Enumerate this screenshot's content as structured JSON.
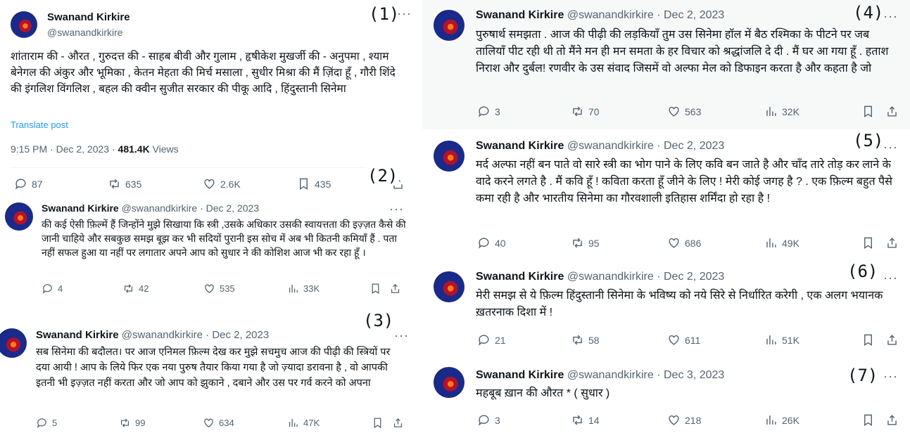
{
  "tweets": [
    {
      "n": "(1)",
      "name": "Swanand Kirkire",
      "handle": "@swanandkirkire",
      "text": "शांताराम की - औरत , गुरुदत्त की - साहब बीवी और गुलाम , हृषीकेश मुखर्जी की - अनुपमा , श्याम बेनेगल की अंकुर और भूमिका , केतन मेहता की मिर्च मसाला , सुधीर मिश्रा की मैं ज़िंदा हूँ , गौरी शिंदे की इंगलिश विंगलिश , बहल की क्वीन सुजीत सरकार की पीकू आदि , हिंदुस्तानी सिनेमा",
      "translate": "Translate post",
      "time": "9:15 PM · Dec 2, 2023 · ",
      "views": "481.4K",
      "views_label": " Views",
      "replies": "87",
      "reposts": "635",
      "likes": "2.6K",
      "bookmarks": "435"
    },
    {
      "n": "(2)",
      "name": "Swanand Kirkire",
      "meta": "@swanandkirkire · Dec 2, 2023",
      "text": "की कई ऐसी  फ़िल्में हैं  जिन्होंने मुझे सिखाया कि स्त्री ,उसके अधिकार उसकी स्वायत्तता की इज़्ज़त कैसे की जानी चाहिये और सबकुछ समझ बूझ कर भी सदियों पुरानी इस सोच में अब भी कितनी कमियाँ हैं . पता नहीं सफल हुआ या नहीं पर लगातार अपने आप को सुधार ने की कोशिश आज भी कर रहा हूँ ।",
      "replies": "4",
      "reposts": "42",
      "likes": "535",
      "views": "33K"
    },
    {
      "n": "(3)",
      "name": "Swanand Kirkire",
      "meta": "@swanandkirkire · Dec 2, 2023",
      "text": "सब सिनेमा की बदौलत।  पर आज एनिमल फ़िल्म देख कर मुझे सचमुच आज की पीढ़ी की स्त्रियों पर दया आयी ! आप के लिये फिर एक नया पुरुष तैयार किया गया है जो ज़्यादा डरावना है , वो आपकी इतनी भी इज़्ज़त नहीं करता और जो आप को झुकाने , दबाने और उस पर  गर्व करने को अपना",
      "replies": "5",
      "reposts": "99",
      "likes": "634",
      "views": "47K"
    },
    {
      "n": "(4)",
      "name": "Swanand Kirkire",
      "meta": "@swanandkirkire · Dec 2, 2023",
      "text": "पुरुषार्थ समझता . आज की पीढ़ी की लड़कियाँ तुम उस सिनेमा हॉल में बैठ रश्मिका के पीटने पर जब तालियाँ पीट रही थी तो मैंने मन ही मन समता के हर विचार को श्रद्धांजलि दे दी . मैं घर आ गया हूँ . हताश निराश और दुर्बल! रणवीर के उस संवाद जिसमें वो अल्फा मेल को डिफाइन करता है और कहता है जो",
      "replies": "3",
      "reposts": "70",
      "likes": "563",
      "views": "32K"
    },
    {
      "n": "(5)",
      "name": "Swanand Kirkire",
      "meta": "@swanandkirkire · Dec 2, 2023",
      "text": "मर्द अल्फा नहीं बन पाते वो सारे स्त्री का भोग पाने के लिए कवि बन जाते है और चाँद तारे तोड़ कर लाने के वादे करने लगते है . मैं कवि हूँ ! कविता करता हूँ जीने के लिए ! मेरी कोई जगह है ? . एक फ़िल्म बहुत पैसे कमा रही है और भारतीय सिनेमा का गौरवशाली इतिहास शर्मिंदा हो रहा है !",
      "replies": "40",
      "reposts": "95",
      "likes": "686",
      "views": "49K"
    },
    {
      "n": "(6)",
      "name": "Swanand Kirkire",
      "meta": "@swanandkirkire · Dec 2, 2023",
      "text": "मेरी समझ से ये फ़िल्म  हिंदुस्तानी सिनेमा के भविष्य को नये सिरे से निर्धारित करेगी , एक अलग भयानक ख़तरनाक दिशा में !",
      "replies": "21",
      "reposts": "58",
      "likes": "611",
      "views": "51K"
    },
    {
      "n": "(7)",
      "name": "Swanand Kirkire",
      "meta": "@swanandkirkire · Dec 3, 2023",
      "text": "महबूब ख़ान की औरत * ( सुधार )",
      "replies": "3",
      "reposts": "14",
      "likes": "218",
      "views": "26K"
    }
  ],
  "icons": {
    "reply": "reply-icon",
    "repost": "repost-icon",
    "like": "heart-icon",
    "views": "views-icon",
    "bookmark": "bookmark-icon",
    "share": "share-icon",
    "more": "more-icon"
  },
  "colors": {
    "link": "#1d9bf0",
    "muted": "#536471",
    "text": "#0f1419"
  }
}
